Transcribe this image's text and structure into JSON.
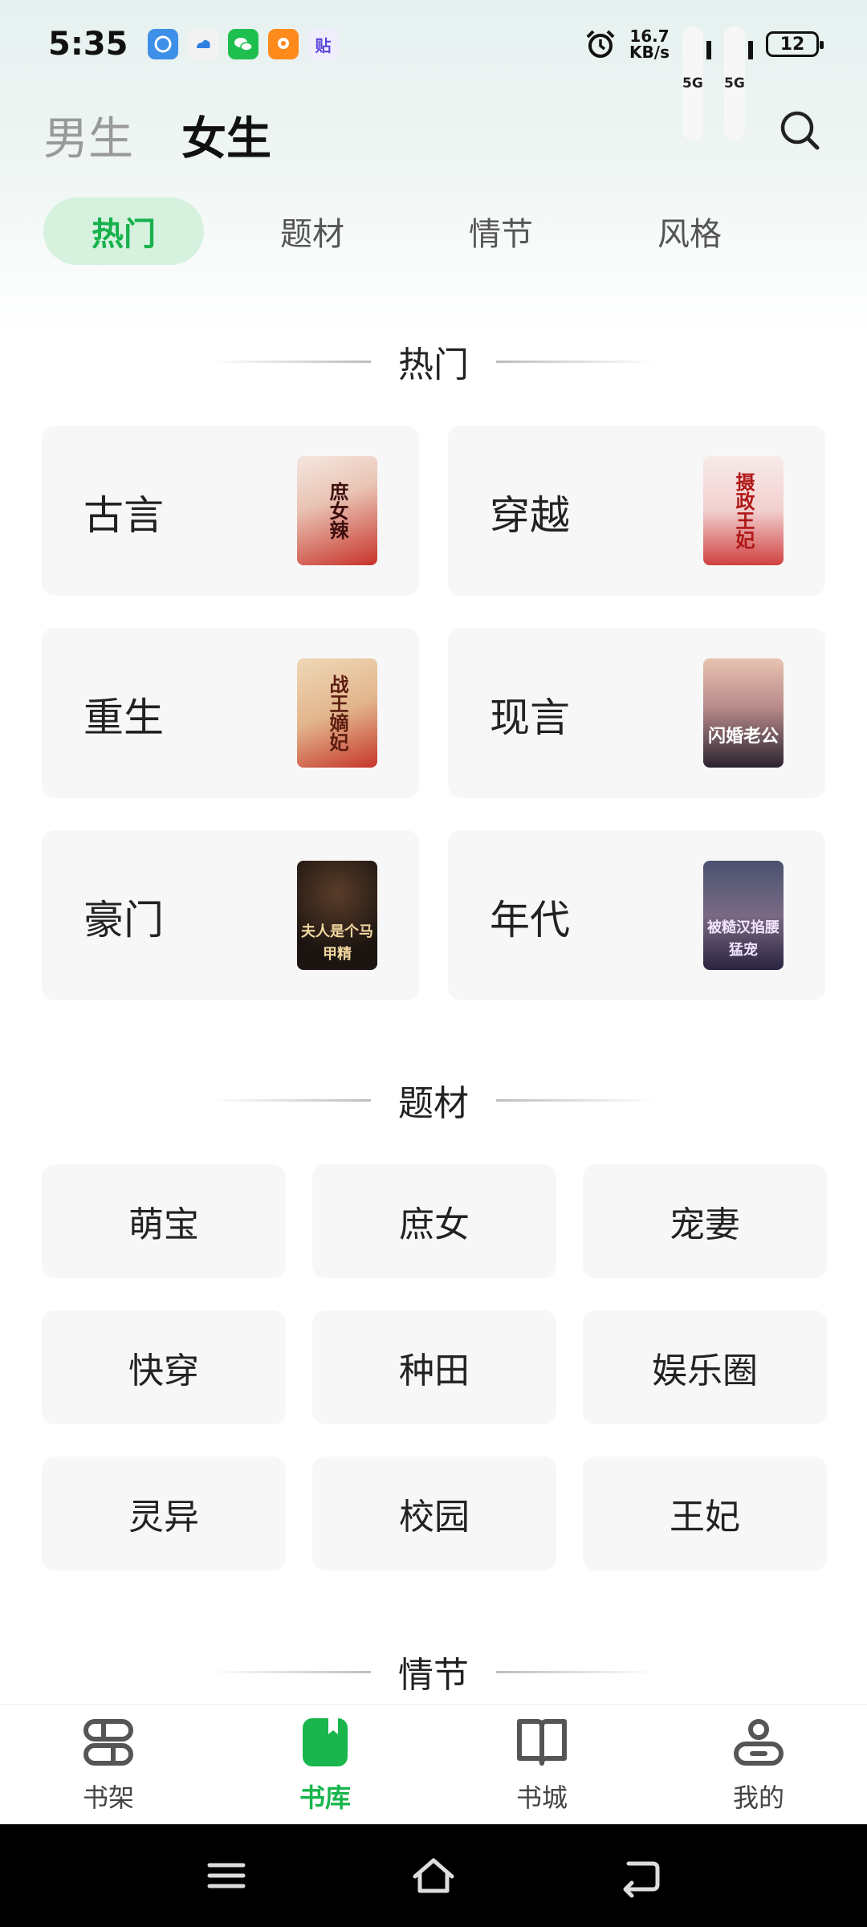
{
  "status_bar": {
    "time": "5:35",
    "net_speed_value": "16.7",
    "net_speed_unit": "KB/s",
    "sim1": "5G",
    "sim2": "5G",
    "battery": "12",
    "app_icons": [
      "app-icon-blue",
      "cloud-app-icon",
      "wechat-icon",
      "orange-app-icon",
      "tie-app-icon"
    ],
    "tie_glyph": "贴"
  },
  "header": {
    "gender_tabs": [
      "男生",
      "女生"
    ],
    "active_gender": "女生"
  },
  "category_tabs": [
    "热门",
    "题材",
    "情节",
    "风格"
  ],
  "sections": {
    "hot": "热门",
    "subject": "题材",
    "plot": "情节"
  },
  "hot_cards": [
    {
      "label": "古言",
      "cover_text": "庶女辣"
    },
    {
      "label": "穿越",
      "cover_text": "摄政王妃"
    },
    {
      "label": "重生",
      "cover_text": "战王嫡妃"
    },
    {
      "label": "现言",
      "cover_text": "闪婚老公"
    },
    {
      "label": "豪门",
      "cover_text": "夫人是个马甲精"
    },
    {
      "label": "年代",
      "cover_text": "被糙汉掐腰猛宠"
    }
  ],
  "subject_tags": [
    "萌宝",
    "庶女",
    "宠妻",
    "快穿",
    "种田",
    "娱乐圈",
    "灵异",
    "校园",
    "王妃"
  ],
  "bottom_nav": [
    {
      "label": "书架",
      "icon": "bookshelf-icon"
    },
    {
      "label": "书库",
      "icon": "library-icon"
    },
    {
      "label": "书城",
      "icon": "open-book-icon"
    },
    {
      "label": "我的",
      "icon": "profile-icon"
    }
  ],
  "active_nav": "书库",
  "colors": {
    "accent": "#18b64c",
    "tab_active_bg": "#d6f2df",
    "card_bg": "#f7f7f7"
  }
}
